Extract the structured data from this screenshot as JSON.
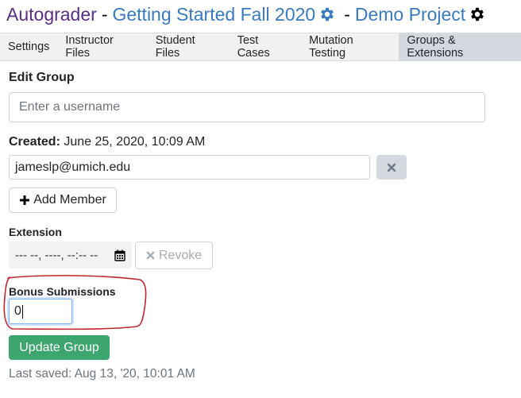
{
  "header": {
    "app_name": "Autograder",
    "course_sep": "-",
    "course_name": "Getting Started Fall 2020",
    "project_sep": "-",
    "project_name": "Demo Project"
  },
  "tabs": [
    {
      "label": "Settings"
    },
    {
      "label": "Instructor Files"
    },
    {
      "label": "Student Files"
    },
    {
      "label": "Test Cases"
    },
    {
      "label": "Mutation Testing"
    },
    {
      "label": "Groups & Extensions",
      "active": true
    }
  ],
  "edit_group": {
    "title": "Edit Group",
    "username_placeholder": "Enter a username",
    "created_label": "Created:",
    "created_value": "June 25, 2020, 10:09 AM",
    "member_email": "jameslp@umich.edu",
    "add_member_label": "Add Member",
    "extension_label": "Extension",
    "extension_value": "--- --, ----, --:-- --",
    "revoke_label": "Revoke",
    "bonus_label": "Bonus Submissions",
    "bonus_value": "0",
    "update_label": "Update Group",
    "last_saved": "Last saved: Aug 13, '20, 10:01 AM"
  },
  "colors": {
    "app_purple": "#5a2d82",
    "link_blue": "#3a7bbf",
    "update_green": "#3da56e",
    "annotation_red": "#c0272d"
  }
}
